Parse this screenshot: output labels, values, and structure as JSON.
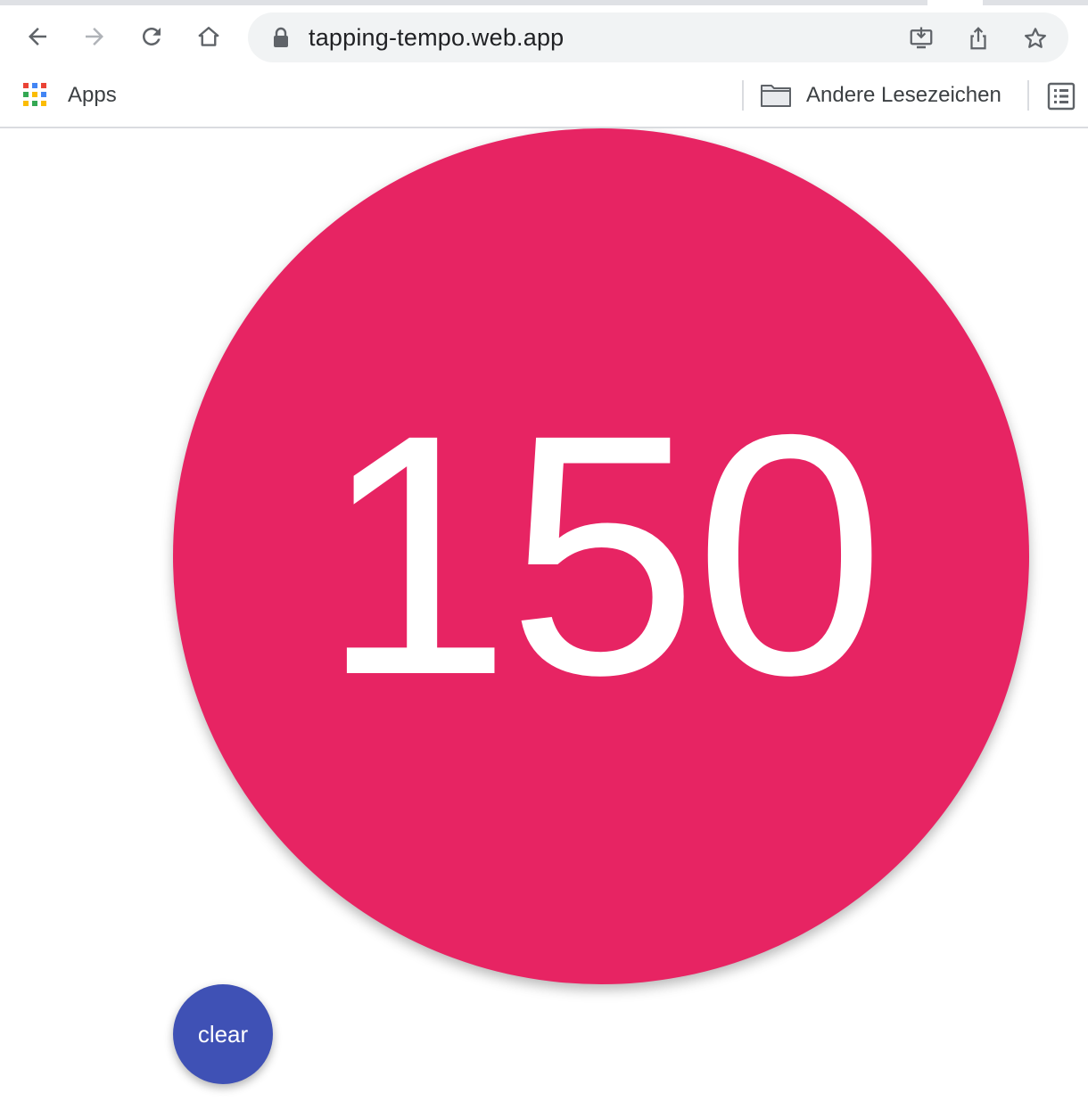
{
  "browser": {
    "toolbar": {
      "back_icon": "arrow-left-icon",
      "forward_icon": "arrow-right-icon",
      "reload_icon": "reload-icon",
      "home_icon": "home-icon"
    },
    "omnibox": {
      "url": "tapping-tempo.web.app",
      "lock_icon": "lock-icon",
      "install_icon": "install-app-icon",
      "share_icon": "share-icon",
      "bookmark_icon": "star-icon"
    },
    "bookmarks_bar": {
      "apps_label": "Apps",
      "other_bookmarks_label": "Andere Lesezeichen",
      "reading_list_icon": "reading-list-icon"
    }
  },
  "app": {
    "tempo_value": "150",
    "clear_label": "clear"
  },
  "colors": {
    "tap_circle": "#e72463",
    "clear_button": "#3f51b5",
    "tempo_text": "#ffffff",
    "omnibox_bg": "#f1f3f4"
  }
}
